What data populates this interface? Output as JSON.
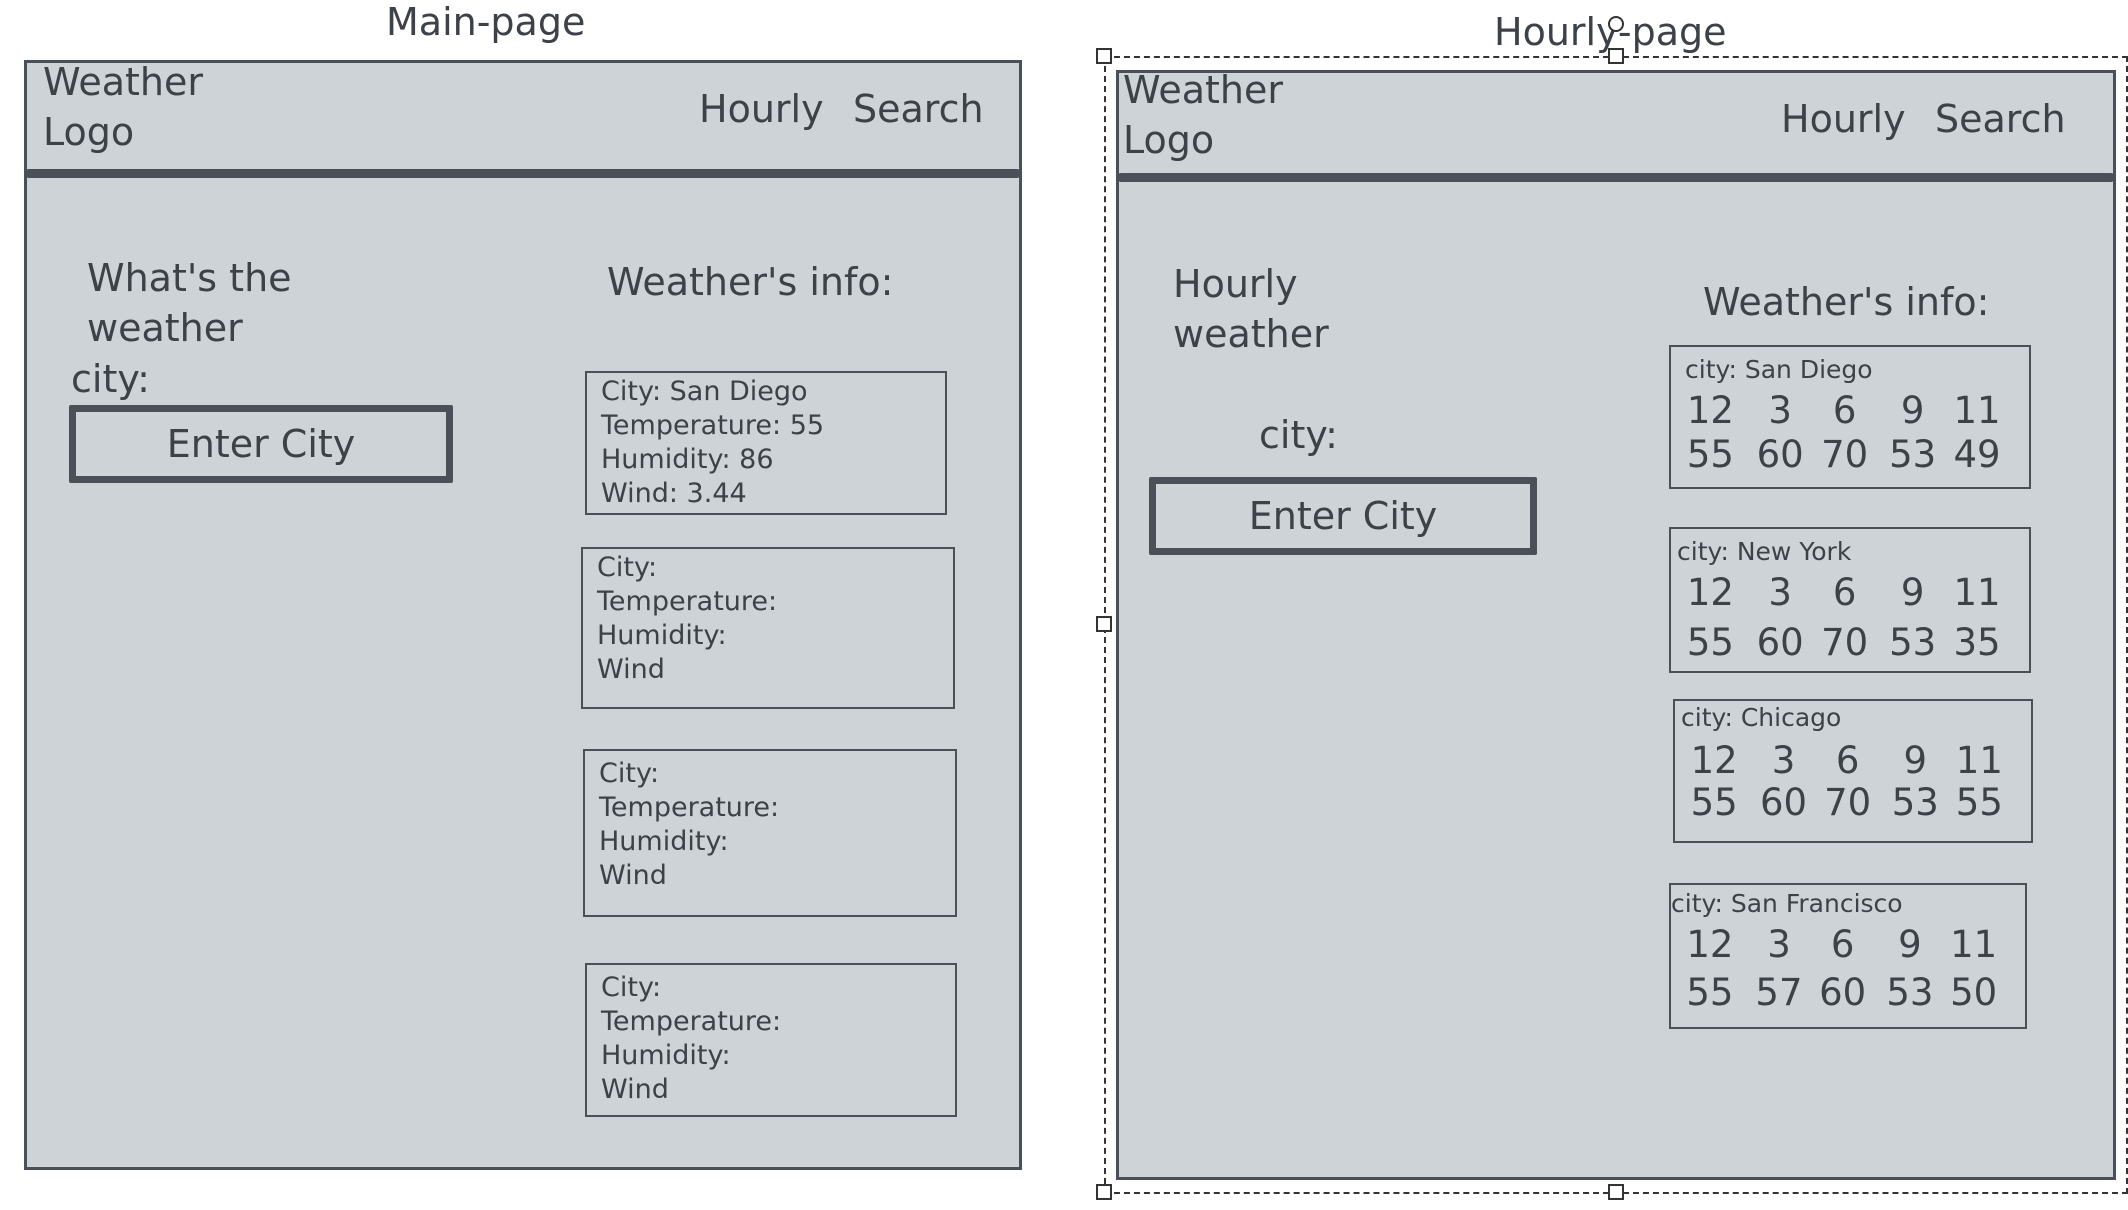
{
  "main_page": {
    "title": "Main-page",
    "logo": "Weather\nLogo",
    "nav": {
      "hourly": "Hourly",
      "search": "Search"
    },
    "heading": "What's the\nweather",
    "city_label": "city:",
    "input_label": "Enter City",
    "info_heading": "Weather's info:",
    "cards": [
      {
        "city": "City:  San Diego",
        "temperature": "Temperature: 55",
        "humidity": "Humidity: 86",
        "wind": "Wind: 3.44"
      },
      {
        "city": "City:",
        "temperature": "Temperature:",
        "humidity": "Humidity:",
        "wind": "Wind"
      },
      {
        "city": "City:",
        "temperature": "Temperature:",
        "humidity": "Humidity:",
        "wind": "Wind"
      },
      {
        "city": "City:",
        "temperature": "Temperature:",
        "humidity": "Humidity:",
        "wind": "Wind"
      }
    ]
  },
  "hourly_page": {
    "title": "Hourly-page",
    "logo": "Weather\nLogo",
    "nav": {
      "hourly": "Hourly",
      "search": "Search"
    },
    "heading": "Hourly\nweather",
    "city_label": "city:",
    "input_label": "Enter City",
    "info_heading": "Weather's info:",
    "cards": [
      {
        "city": "city: San Diego",
        "hours": [
          "12",
          "3",
          "6",
          "9",
          "11"
        ],
        "temps": [
          "55",
          "60",
          "70",
          "53",
          "49"
        ]
      },
      {
        "city": "city: New York",
        "hours": [
          "12",
          "3",
          "6",
          "9",
          "11"
        ],
        "temps": [
          "55",
          "60",
          "70",
          "53",
          "35"
        ]
      },
      {
        "city": "city: Chicago",
        "hours": [
          "12",
          "3",
          "6",
          "9",
          "11"
        ],
        "temps": [
          "55",
          "60",
          "70",
          "53",
          "55"
        ]
      },
      {
        "city": "city: San Francisco",
        "hours": [
          "12",
          "3",
          "6",
          "9",
          "11"
        ],
        "temps": [
          "55",
          "57",
          "60",
          "53",
          "50"
        ]
      }
    ]
  }
}
